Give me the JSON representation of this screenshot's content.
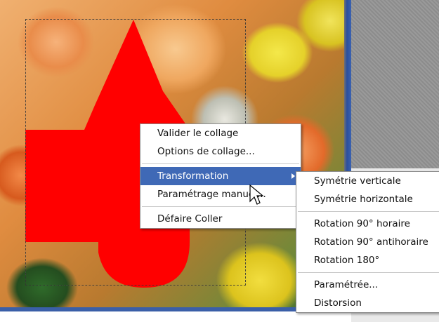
{
  "context_menu": {
    "items": [
      {
        "label": "Valider le collage"
      },
      {
        "label": "Options de collage..."
      },
      {
        "label": "Transformation"
      },
      {
        "label": "Paramétrage manuel..."
      },
      {
        "label": "Défaire Coller"
      }
    ]
  },
  "submenu": {
    "items": [
      {
        "label": "Symétrie verticale"
      },
      {
        "label": "Symétrie horizontale"
      },
      {
        "label": "Rotation 90° horaire"
      },
      {
        "label": "Rotation 90° antihoraire"
      },
      {
        "label": "Rotation 180°"
      },
      {
        "label": "Paramétrée..."
      },
      {
        "label": "Distorsion"
      }
    ]
  },
  "colors": {
    "pasted_shape": "#ff0000",
    "menu_highlight": "#3f69b6"
  },
  "icons": [
    "submenu-arrow-icon",
    "mouse-pointer-icon"
  ]
}
